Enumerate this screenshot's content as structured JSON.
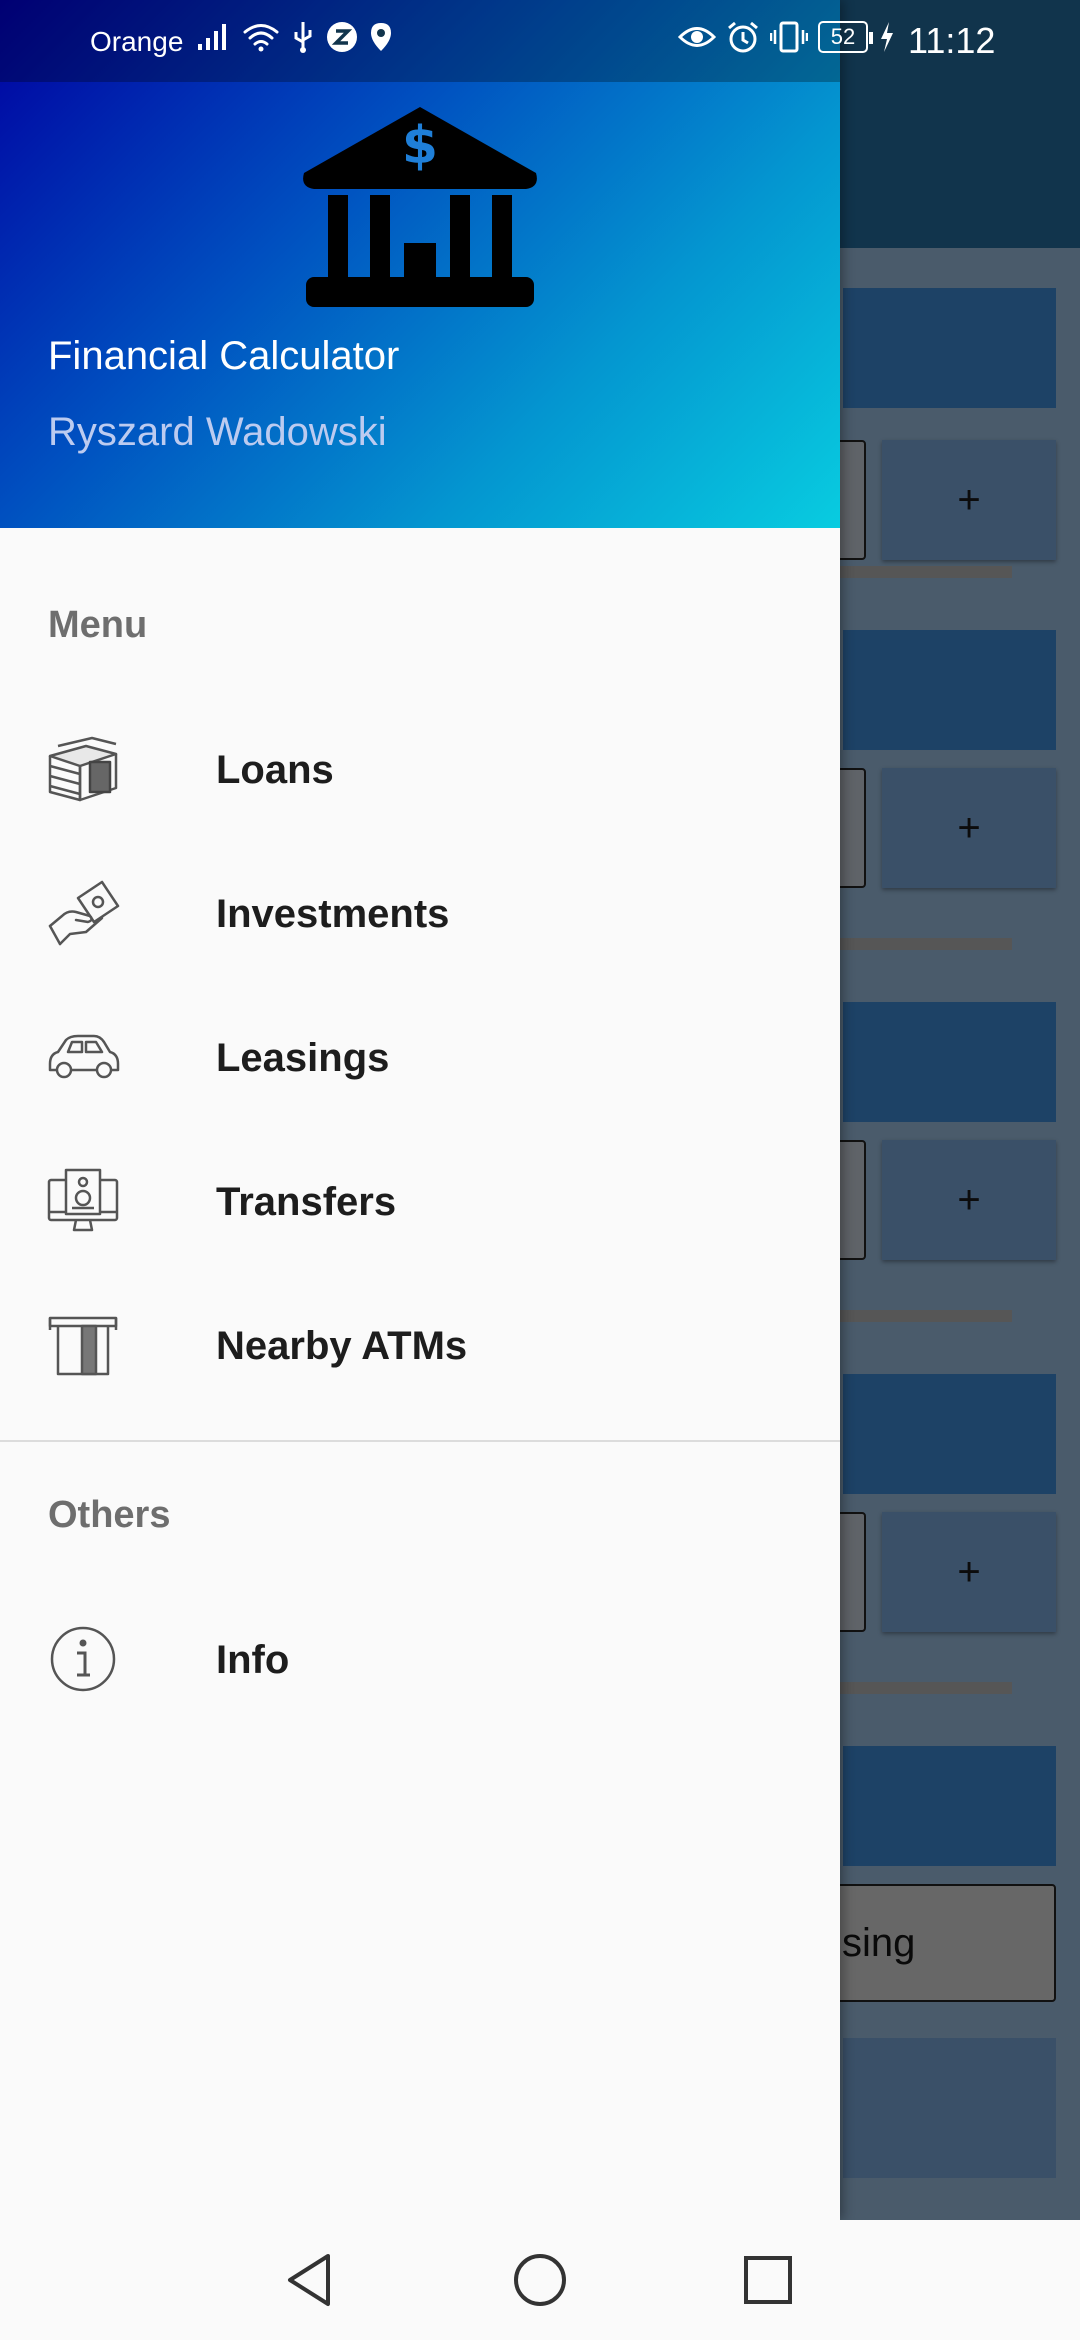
{
  "status_bar": {
    "carrier": "Orange",
    "battery": "52",
    "time": "11:12"
  },
  "drawer": {
    "header": {
      "logo_symbol": "$",
      "app_title": "Financial Calculator",
      "user_name": "Ryszard Wadowski"
    },
    "sections": {
      "menu_title": "Menu",
      "others_title": "Others"
    },
    "menu_items": [
      {
        "label": "Loans",
        "icon": "money-stack-icon"
      },
      {
        "label": "Investments",
        "icon": "hand-money-icon"
      },
      {
        "label": "Leasings",
        "icon": "car-icon"
      },
      {
        "label": "Transfers",
        "icon": "monitor-transfer-icon"
      },
      {
        "label": "Nearby ATMs",
        "icon": "atm-card-icon"
      }
    ],
    "other_items": [
      {
        "label": "Info",
        "icon": "info-icon"
      }
    ]
  },
  "background": {
    "plus_label": "+",
    "button_fragment": "sing"
  },
  "colors": {
    "header_gradient_start": "#0000a0",
    "header_gradient_end": "#08cce0",
    "toolbar": "#11344c",
    "drawer_bg": "#fafafa"
  }
}
